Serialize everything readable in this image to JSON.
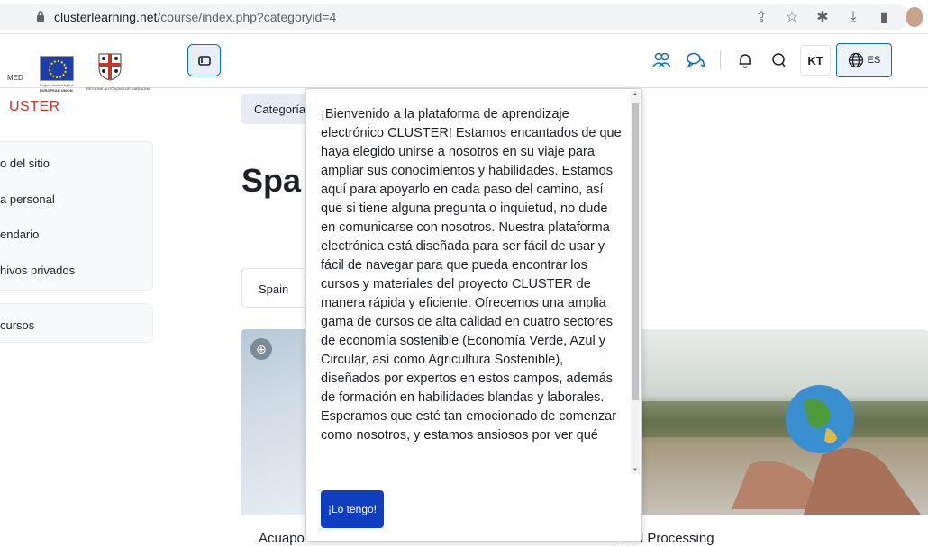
{
  "browser": {
    "url_domain": "clusterlearning.net",
    "url_path": "/course/index.php?categoryid=4",
    "icons": [
      "share-icon",
      "star-icon",
      "extensions-icon",
      "download-icon",
      "sidebar-icon",
      "profile-avatar"
    ]
  },
  "logos": {
    "eu_caption": "EUROPEAN UNION",
    "eu_small": "Project funded by the",
    "sardegna_small": "REGIONE AUTONOMA DE SARDIGNA",
    "med": "MED",
    "brand": "USTER"
  },
  "navbar": {
    "user_initials": "KT",
    "language": "ES"
  },
  "sidebar": {
    "items": [
      {
        "label": "o del sitio"
      },
      {
        "label": "a personal"
      },
      {
        "label": "endario"
      },
      {
        "label": "hivos privados"
      }
    ],
    "courses_label": "cursos"
  },
  "main": {
    "breadcrumb": "Categoría",
    "title": "Spa",
    "select_value": "Spain",
    "cards": [
      {
        "label": "Acuapo"
      },
      {
        "label": "Food Processing"
      }
    ]
  },
  "popover": {
    "text": "¡Bienvenido a la plataforma de aprendizaje electrónico CLUSTER! Estamos encantados de que haya elegido unirse a nosotros en su viaje para ampliar sus conocimientos y habilidades. Estamos aquí para apoyarlo en cada paso del camino, así que si tiene alguna pregunta o inquietud, no dude en comunicarse con nosotros. Nuestra plataforma electrónica está diseñada para ser fácil de usar y fácil de navegar para que pueda encontrar los cursos y materiales del proyecto CLUSTER de manera rápida y eficiente. Ofrecemos una amplia gama de cursos de alta calidad en cuatro sectores de economía sostenible (Economía Verde, Azul y Circular, así como Agricultura Sostenible), diseñados por expertos en estos campos, además de formación en habilidades blandas y laborales. Esperamos que esté tan emocionado de comenzar como nosotros, y estamos ansiosos por ver qué",
    "button_label": "¡Lo tengo!"
  },
  "colors": {
    "primary": "#0f6cbf",
    "button": "#0f3fbf",
    "brand_red": "#c0392b"
  }
}
